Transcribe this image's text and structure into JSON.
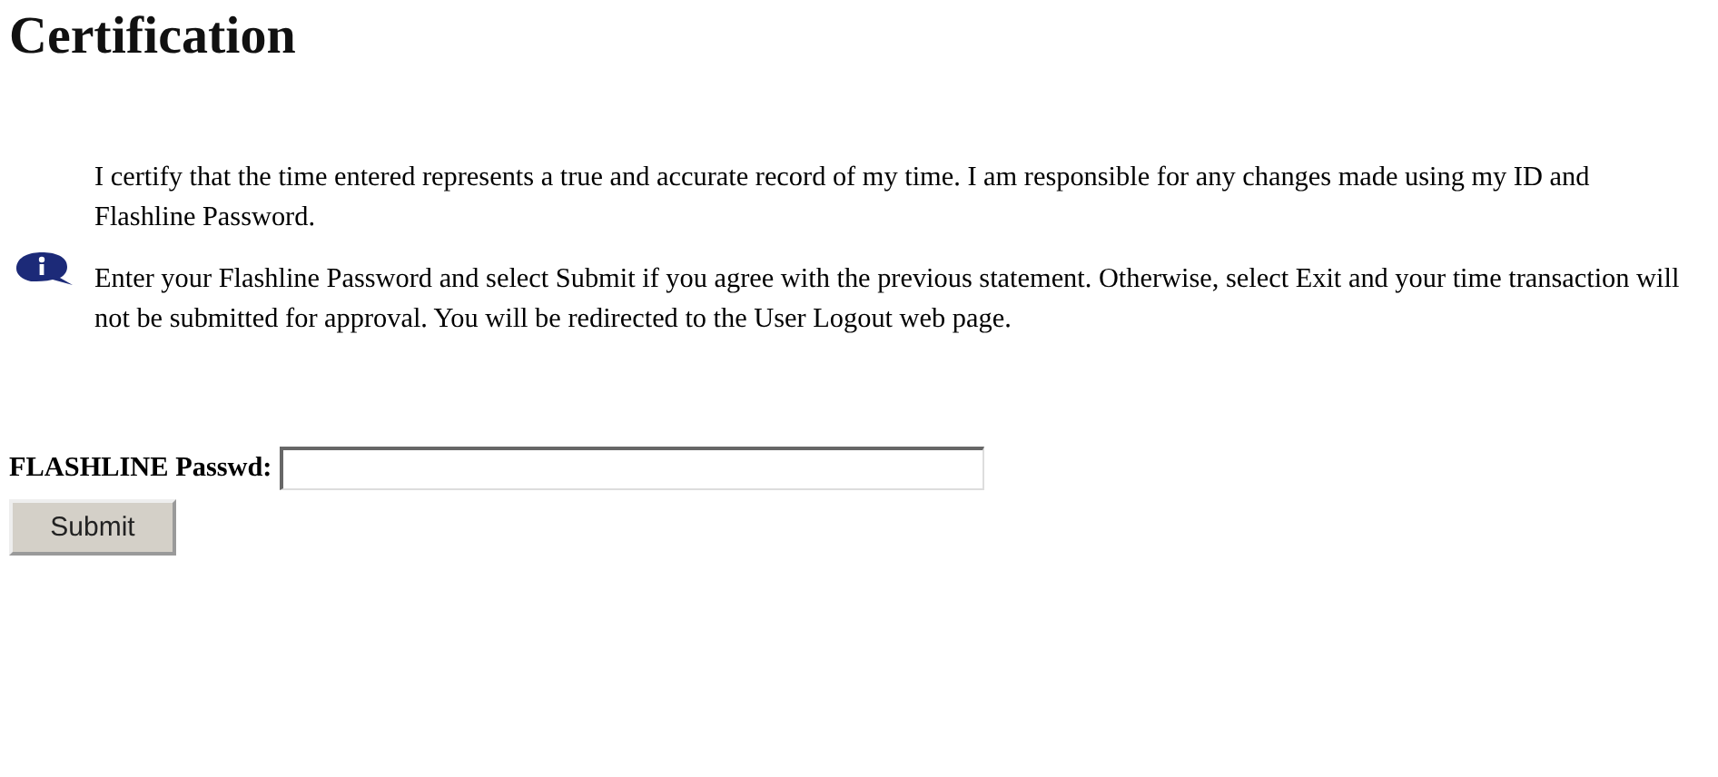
{
  "heading": "Certification",
  "statement": "I certify that the time entered represents a true and accurate record of my time. I am responsible for any changes made using my ID and Flashline Password.",
  "info": "Enter your Flashline Password and select Submit if you agree with the previous statement. Otherwise, select Exit and your time transaction will not be submitted for approval. You will be redirected to the User Logout web page.",
  "password": {
    "label": "FLASHLINE Passwd:"
  },
  "buttons": [
    "Submit"
  ]
}
